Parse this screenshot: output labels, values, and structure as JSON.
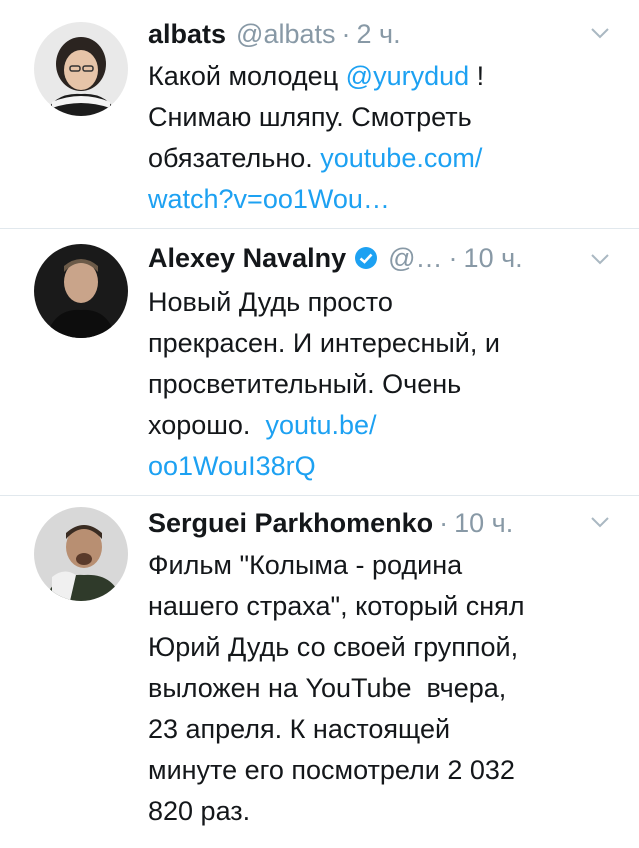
{
  "tweets": [
    {
      "name": "albats",
      "handle": "@albats",
      "time": "2 ч.",
      "verified": false,
      "text_parts": [
        {
          "t": "Какой молодец ",
          "link": false
        },
        {
          "t": "@yurydud",
          "link": true
        },
        {
          "t": " !\nСнимаю шляпу. Смотреть\nобязательно. ",
          "link": false
        },
        {
          "t": "youtube.com/\nwatch?v=oo1Wou…",
          "link": true
        }
      ]
    },
    {
      "name": "Alexey Navalny",
      "handle": "@…",
      "time": "10 ч.",
      "verified": true,
      "text_parts": [
        {
          "t": "Новый Дудь просто\nпрекрасен. И интересный, и\nпросветительный. Очень\nхорошо.  ",
          "link": false
        },
        {
          "t": "youtu.be/\noo1WouI38rQ",
          "link": true
        }
      ]
    },
    {
      "name": "Serguei Parkhomenko",
      "handle": "",
      "time": "10 ч.",
      "verified": false,
      "text_parts": [
        {
          "t": "Фильм \"Колыма - родина\nнашего страха\", который снял\nЮрий Дудь со своей группой,\nвыложен на YouTube  вчера,\n23 апреля. К настоящей\nминуте его посмотрели 2 032\n820 раз.",
          "link": false
        }
      ]
    }
  ],
  "colors": {
    "link": "#1da1f2",
    "meta": "#8899a6",
    "divider": "#e1e8ed",
    "verified": "#1da1f2"
  },
  "icons": [
    "chevron-down-icon",
    "verified-badge-icon"
  ]
}
